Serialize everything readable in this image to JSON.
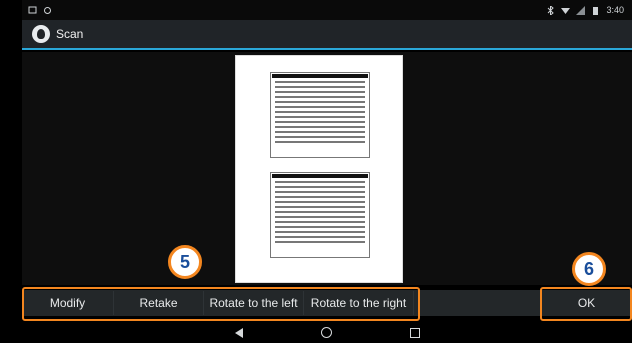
{
  "status_bar": {
    "time": "3:40",
    "icons": [
      "notification-icon",
      "settings-icon",
      "bluetooth-icon",
      "wifi-icon",
      "signal-icon",
      "battery-icon"
    ]
  },
  "app": {
    "title": "Scan"
  },
  "toolbar": {
    "modify_label": "Modify",
    "retake_label": "Retake",
    "rotate_left_label": "Rotate to the left",
    "rotate_right_label": "Rotate to the right",
    "ok_label": "OK"
  },
  "callouts": {
    "badge_left": "5",
    "badge_right": "6"
  },
  "colors": {
    "accent_blue": "#2aa7d8",
    "callout_orange": "#f3861f",
    "badge_text": "#1a4e9b"
  }
}
